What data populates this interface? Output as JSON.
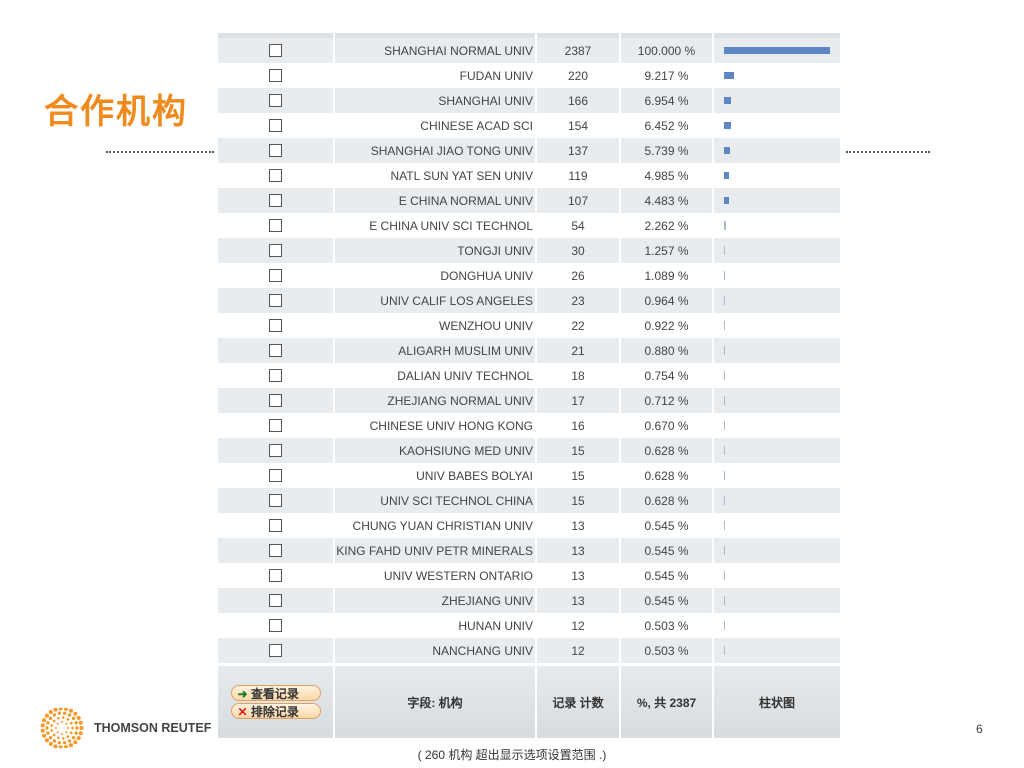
{
  "slide": {
    "title": "合作机构",
    "page_number": "6",
    "logo_text": "THOMSON REUTEF",
    "note": "( 260 机构  超出显示选项设置范围  .)"
  },
  "colors": {
    "accent": "#f08a1c",
    "bar": "#5f86c4"
  },
  "table": {
    "total": 2387,
    "rows": [
      {
        "name": "SHANGHAI NORMAL UNIV",
        "count": "2387",
        "pct": "100.000 %"
      },
      {
        "name": "FUDAN UNIV",
        "count": "220",
        "pct": "9.217 %"
      },
      {
        "name": "SHANGHAI UNIV",
        "count": "166",
        "pct": "6.954 %"
      },
      {
        "name": "CHINESE ACAD SCI",
        "count": "154",
        "pct": "6.452 %"
      },
      {
        "name": "SHANGHAI JIAO TONG UNIV",
        "count": "137",
        "pct": "5.739 %"
      },
      {
        "name": "NATL SUN YAT SEN UNIV",
        "count": "119",
        "pct": "4.985 %"
      },
      {
        "name": "E CHINA NORMAL UNIV",
        "count": "107",
        "pct": "4.483 %"
      },
      {
        "name": "E CHINA UNIV SCI TECHNOL",
        "count": "54",
        "pct": "2.262 %"
      },
      {
        "name": "TONGJI UNIV",
        "count": "30",
        "pct": "1.257 %"
      },
      {
        "name": "DONGHUA UNIV",
        "count": "26",
        "pct": "1.089 %"
      },
      {
        "name": "UNIV CALIF LOS ANGELES",
        "count": "23",
        "pct": "0.964 %"
      },
      {
        "name": "WENZHOU UNIV",
        "count": "22",
        "pct": "0.922 %"
      },
      {
        "name": "ALIGARH MUSLIM UNIV",
        "count": "21",
        "pct": "0.880 %"
      },
      {
        "name": "DALIAN UNIV TECHNOL",
        "count": "18",
        "pct": "0.754 %"
      },
      {
        "name": "ZHEJIANG NORMAL UNIV",
        "count": "17",
        "pct": "0.712 %"
      },
      {
        "name": "CHINESE UNIV HONG KONG",
        "count": "16",
        "pct": "0.670 %"
      },
      {
        "name": "KAOHSIUNG MED UNIV",
        "count": "15",
        "pct": "0.628 %"
      },
      {
        "name": "UNIV BABES BOLYAI",
        "count": "15",
        "pct": "0.628 %"
      },
      {
        "name": "UNIV SCI TECHNOL CHINA",
        "count": "15",
        "pct": "0.628 %"
      },
      {
        "name": "CHUNG YUAN CHRISTIAN UNIV",
        "count": "13",
        "pct": "0.545 %"
      },
      {
        "name": "KING FAHD UNIV PETR MINERALS",
        "count": "13",
        "pct": "0.545 %"
      },
      {
        "name": "UNIV WESTERN ONTARIO",
        "count": "13",
        "pct": "0.545 %"
      },
      {
        "name": "ZHEJIANG UNIV",
        "count": "13",
        "pct": "0.545 %"
      },
      {
        "name": "HUNAN UNIV",
        "count": "12",
        "pct": "0.503 %"
      },
      {
        "name": "NANCHANG UNIV",
        "count": "12",
        "pct": "0.503 %"
      }
    ],
    "footer": {
      "view_button": "查看记录",
      "exclude_button": "排除记录",
      "field": "字段: 机构",
      "count": "记录  计数",
      "pct": "%,  共  2387",
      "chart": "柱状图"
    }
  }
}
